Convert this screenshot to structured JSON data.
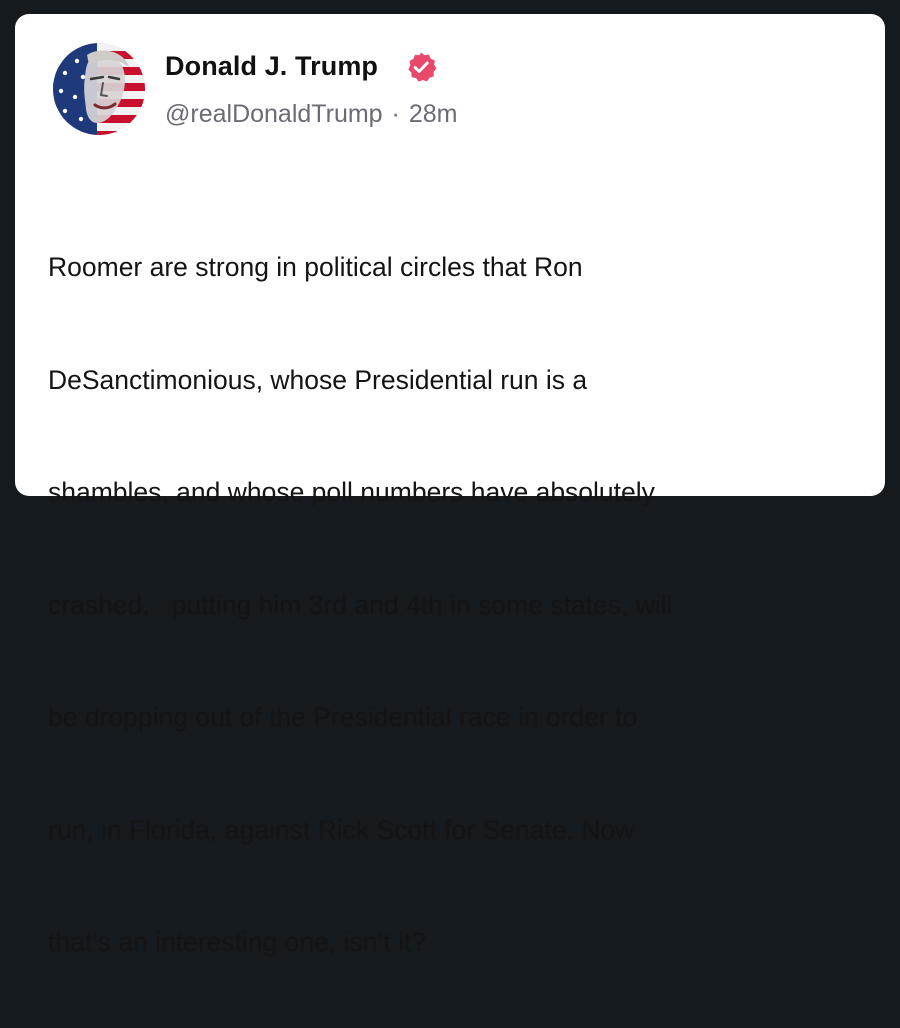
{
  "post": {
    "author": {
      "display_name": "Donald J. Trump",
      "handle": "@realDonaldTrump",
      "verified_icon": "verified-badge-icon",
      "avatar_icon": "profile-avatar"
    },
    "separator": "·",
    "time_ago": "28m",
    "lines": [
      "Roomer are strong in political circles that Ron",
      "DeSanctimonious, whose Presidential run is a",
      "shambles, and whose poll numbers have absolutely",
      "crashed,   putting him 3rd and 4th in some states, will",
      "be dropping out of the Presidential race in order to",
      "run, in Florida, against Rick Scott for Senate. Now",
      "that’s an interesting one, isn’t it?"
    ]
  },
  "colors": {
    "background": "#141a1d",
    "card": "#ffffff",
    "verified": "#e8486a",
    "text": "#141414",
    "muted": "#6b6b75"
  }
}
